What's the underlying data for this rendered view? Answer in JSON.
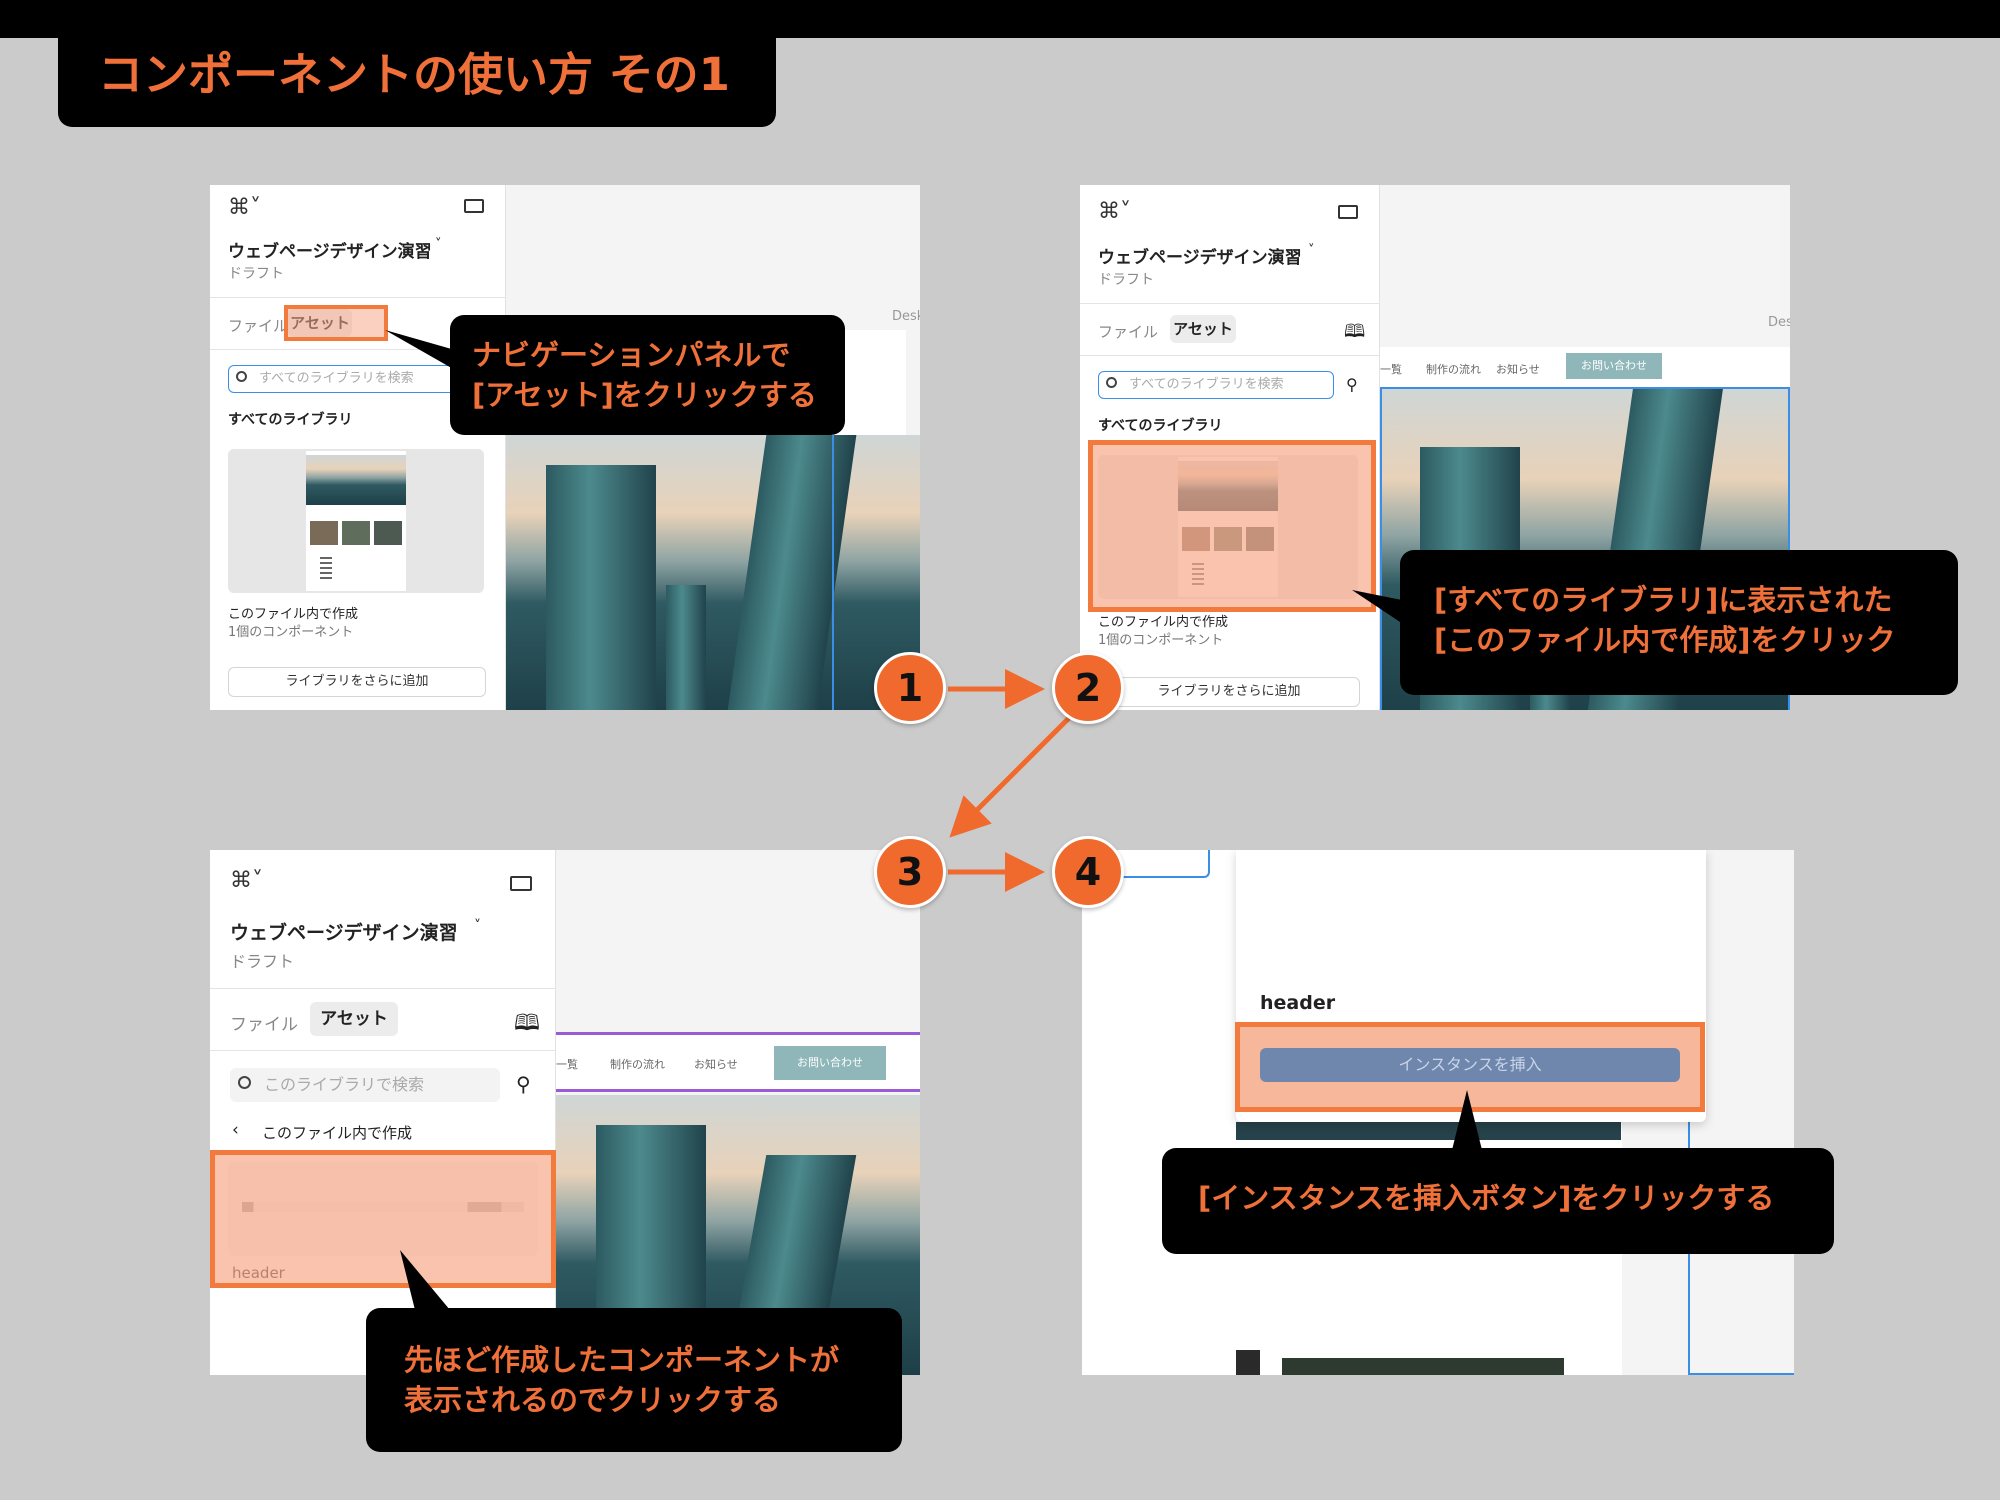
{
  "slide_title": "コンポーネントの使い方 その1",
  "steps": [
    "1",
    "2",
    "3",
    "4"
  ],
  "figma": {
    "project_name": "ウェブページデザイン演習",
    "draft_label": "ドラフト",
    "tab_file": "ファイル",
    "tab_assets": "アセット",
    "search_all_placeholder": "すべてのライブラリを検索",
    "search_lib_placeholder": "このライブラリで検索",
    "all_libraries": "すべてのライブラリ",
    "library_name": "このファイル内で作成",
    "library_count": "1個のコンポーネント",
    "add_library_button": "ライブラリをさらに追加",
    "back_label": "このファイル内で作成",
    "component_name": "header",
    "insert_instance_button": "インスタンスを挿入",
    "canvas_frame_label": "Desk"
  },
  "site_nav": {
    "item1": "一覧",
    "item2": "制作の流れ",
    "item3": "お知らせ",
    "contact": "お問い合わせ",
    "item1_b": "実績一覧"
  },
  "callouts": {
    "step1": [
      "ナビゲーションパネルで",
      "[アセット]をクリックする"
    ],
    "step2": [
      "[すべてのライブラリ]に表示された",
      "[このファイル内で作成]をクリック"
    ],
    "step3": [
      "先ほど作成したコンポーネントが",
      "表示されるのでクリックする"
    ],
    "step4": [
      "[インスタンスを挿入ボタン]をクリックする"
    ]
  },
  "colors": {
    "accent": "#f0703a",
    "highlight_fill": "#f8aa8c",
    "insert_button": "#6f87ad"
  }
}
